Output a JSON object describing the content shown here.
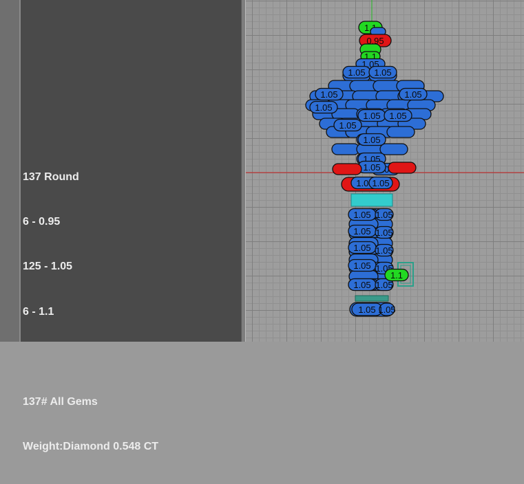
{
  "info": {
    "lines": [
      "137 Round",
      "6 - 0.95",
      "125 - 1.05",
      "6 - 1.1",
      "",
      "137# All Gems",
      "Weight:Diamond 0.548 CT"
    ]
  },
  "gem_sizes": {
    "small": "0.95",
    "medium": "1.05",
    "large": "1.1"
  },
  "colors": {
    "small": "#e01616",
    "medium": "#2d6ed6",
    "large": "#22d822",
    "setting": "#33cccc",
    "axis_x": "#cc2222",
    "axis_y": "#22bb22"
  }
}
